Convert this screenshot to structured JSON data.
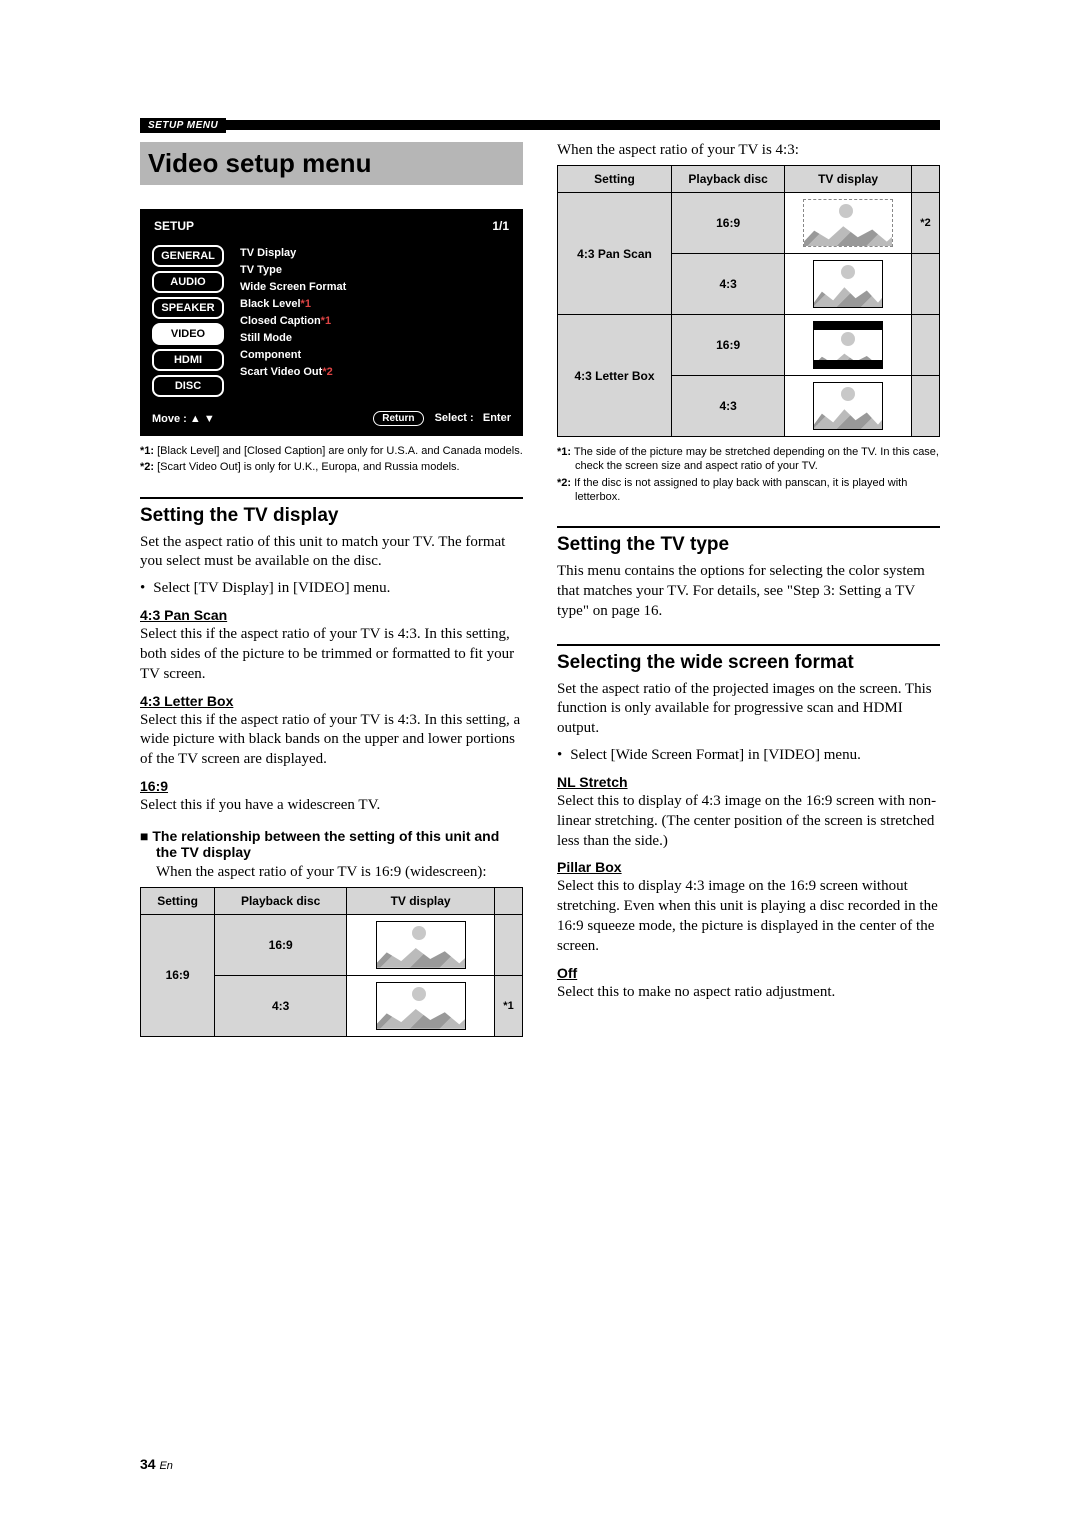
{
  "header": {
    "breadcrumb": "SETUP MENU"
  },
  "title": "Video setup menu",
  "setup_panel": {
    "title": "SETUP",
    "page": "1/1",
    "tabs": [
      "GENERAL",
      "AUDIO",
      "SPEAKER",
      "VIDEO",
      "HDMI",
      "DISC"
    ],
    "selected_tab": "VIDEO",
    "items": [
      {
        "label": "TV Display"
      },
      {
        "label": "TV Type"
      },
      {
        "label": "Wide Screen Format"
      },
      {
        "label": "Black Level",
        "note": "*1"
      },
      {
        "label": "Closed Caption",
        "note": "*1"
      },
      {
        "label": "Still Mode"
      },
      {
        "label": "Component"
      },
      {
        "label": "Scart Video Out",
        "note": "*2"
      }
    ],
    "footer": {
      "move": "Move :",
      "return": "Return",
      "select": "Select :",
      "enter": "Enter"
    }
  },
  "panel_footnotes": [
    {
      "star": "*1:",
      "text": "[Black Level] and [Closed Caption] are only for U.S.A. and Canada models."
    },
    {
      "star": "*2:",
      "text": "[Scart Video Out] is only for U.K., Europa, and Russia models."
    }
  ],
  "left": {
    "h2_tvdisp": "Setting the TV display",
    "p_tvdisp": "Set the aspect ratio of this unit to match your TV. The format you select must be available on the disc.",
    "bul_tvdisp": "Select [TV Display] in [VIDEO] menu.",
    "h3_pan": "4:3 Pan Scan",
    "p_pan": "Select this if the aspect ratio of your TV is 4:3. In this setting, both sides of the picture to be trimmed or formatted to fit your TV screen.",
    "h3_letter": "4:3 Letter Box",
    "p_letter": "Select this if the aspect ratio of your TV is 4:3. In this setting, a wide picture with black bands on the upper and lower portions of the TV screen are displayed.",
    "h3_169": "16:9",
    "p_169": "Select this if you have a widescreen TV.",
    "h4_rel": "The relationship between the setting of this unit and the TV display",
    "p_rel": "When the aspect ratio of your TV is 16:9 (widescreen):",
    "t1_head": {
      "setting": "Setting",
      "disc": "Playback disc",
      "display": "TV display"
    },
    "t1": {
      "setting": "16:9",
      "rows": [
        {
          "disc": "16:9",
          "note": ""
        },
        {
          "disc": "4:3",
          "note": "*1"
        }
      ]
    }
  },
  "right": {
    "p_top": "When the aspect ratio of your TV is 4:3:",
    "t2_head": {
      "setting": "Setting",
      "disc": "Playback disc",
      "display": "TV display"
    },
    "t2": [
      {
        "setting": "4:3 Pan Scan",
        "rows": [
          {
            "disc": "16:9",
            "note": "*2"
          },
          {
            "disc": "4:3",
            "note": ""
          }
        ]
      },
      {
        "setting": "4:3 Letter Box",
        "rows": [
          {
            "disc": "16:9",
            "note": ""
          },
          {
            "disc": "4:3",
            "note": ""
          }
        ]
      }
    ],
    "fns": [
      {
        "star": "*1:",
        "text": "The side of the picture may be stretched depending on the TV. In this case, check the screen size and aspect ratio of your TV."
      },
      {
        "star": "*2:",
        "text": "If the disc is not assigned to play back with panscan, it is played with letterbox."
      }
    ],
    "h2_tvtype": "Setting the TV type",
    "p_tvtype": "This menu contains the options for selecting the color system that matches your TV. For details, see \"Step 3: Setting a TV type\" on page 16.",
    "h2_wide": "Selecting the wide screen format",
    "p_wide": "Set the aspect ratio of the projected images on the screen. This function is only available for progressive scan and HDMI output.",
    "bul_wide": "Select [Wide Screen Format] in [VIDEO] menu.",
    "h3_nl": "NL Stretch",
    "p_nl": "Select this to display of 4:3 image on the 16:9 screen with non-linear stretching. (The center position of the screen is stretched less than the side.)",
    "h3_pillar": "Pillar Box",
    "p_pillar": "Select this to display 4:3 image on the 16:9 screen without stretching. Even when this unit is playing a disc recorded in the 16:9 squeeze mode, the picture is displayed in the center of the screen.",
    "h3_off": "Off",
    "p_off": "Select this to make no aspect ratio adjustment."
  },
  "pagenum": {
    "num": "34",
    "lang": "En"
  }
}
